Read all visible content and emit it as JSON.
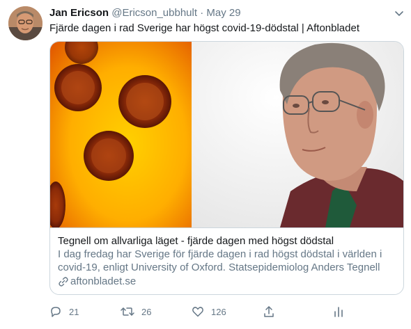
{
  "tweet": {
    "author_name": "Jan Ericson",
    "author_handle": "@Ericson_ubbhult",
    "separator": "·",
    "date": "May 29",
    "text": "Fjärde dagen i rad Sverige har högst covid-19-dödstal | Aftonbladet"
  },
  "card": {
    "title": "Tegnell om allvarliga läget - fjärde dagen med högst dödstal",
    "description": "I dag fredag har Sverige för fjärde dagen i rad högst dödstal i världen i covid-19, enligt University of Oxford. Statsepidemiolog Anders Tegnell s...",
    "domain": "aftonbladet.se"
  },
  "actions": {
    "reply_count": "21",
    "retweet_count": "26",
    "like_count": "126"
  },
  "icons": [
    "chevron-down-icon",
    "link-icon",
    "reply-icon",
    "retweet-icon",
    "like-icon",
    "share-icon",
    "analytics-icon"
  ],
  "colors": {
    "text_primary": "#14171a",
    "text_secondary": "#657786",
    "border": "#ccd6dd"
  }
}
